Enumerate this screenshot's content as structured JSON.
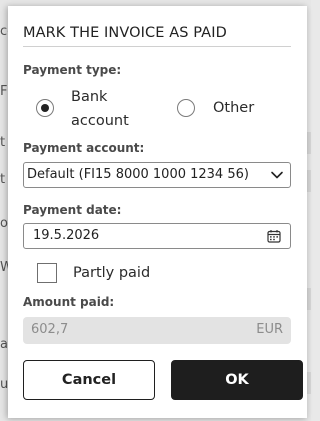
{
  "background": {
    "fragments": [
      "co",
      "F",
      "t",
      "t",
      "ot",
      "W",
      "a",
      "u"
    ]
  },
  "dialog": {
    "title": "MARK THE INVOICE AS PAID",
    "payment_type": {
      "label": "Payment type:",
      "options": [
        {
          "label_line1": "Bank",
          "label_line2": "account",
          "selected": true
        },
        {
          "label": "Other",
          "selected": false
        }
      ]
    },
    "payment_account": {
      "label": "Payment account:",
      "value": "Default (FI15 8000 1000 1234 56)"
    },
    "payment_date": {
      "label": "Payment date:",
      "value": "19.5.2026"
    },
    "partly_paid": {
      "label": "Partly paid",
      "checked": false
    },
    "amount_paid": {
      "label": "Amount paid:",
      "value": "602,7",
      "currency": "EUR"
    },
    "buttons": {
      "cancel": "Cancel",
      "ok": "OK"
    }
  },
  "icons": {
    "select": "chevron-down-icon",
    "date": "calendar-icon"
  }
}
